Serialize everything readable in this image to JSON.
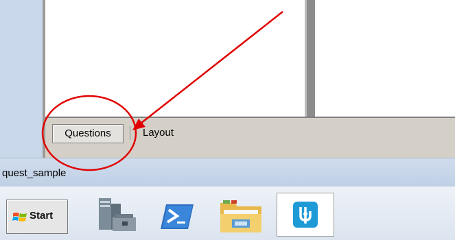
{
  "tabs": [
    {
      "label": "Questions",
      "active": true
    },
    {
      "label": "Layout",
      "active": false
    }
  ],
  "status_bar": {
    "text": "quest_sample"
  },
  "taskbar": {
    "start_label": "Start",
    "icons": [
      "server-manager-icon",
      "powershell-icon",
      "file-explorer-icon",
      "app-icon"
    ]
  },
  "annotation": {
    "color": "#e00000"
  }
}
